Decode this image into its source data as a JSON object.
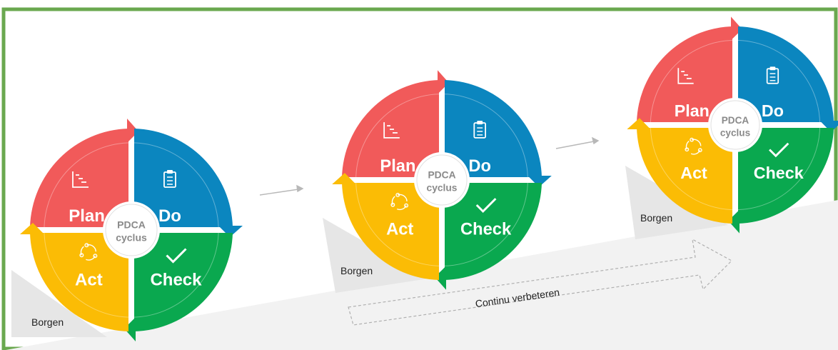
{
  "colors": {
    "frame": "#6aa84f",
    "plan": "#f15a5a",
    "do": "#0b86bf",
    "check": "#0aa84f",
    "act": "#fbbc05",
    "ramp": "#f2f2f2",
    "center_text": "#8a8a8a"
  },
  "segments": {
    "plan": "Plan",
    "do": "Do",
    "check": "Check",
    "act": "Act"
  },
  "center": {
    "line1": "PDCA",
    "line2": "cyclus"
  },
  "icons": {
    "plan": "gantt-chart-icon",
    "do": "clipboard-checklist-icon",
    "check": "checkmark-icon",
    "act": "cycle-arrows-icon"
  },
  "wedge_label": "Borgen",
  "ramp_label": "Continu verbeteren"
}
